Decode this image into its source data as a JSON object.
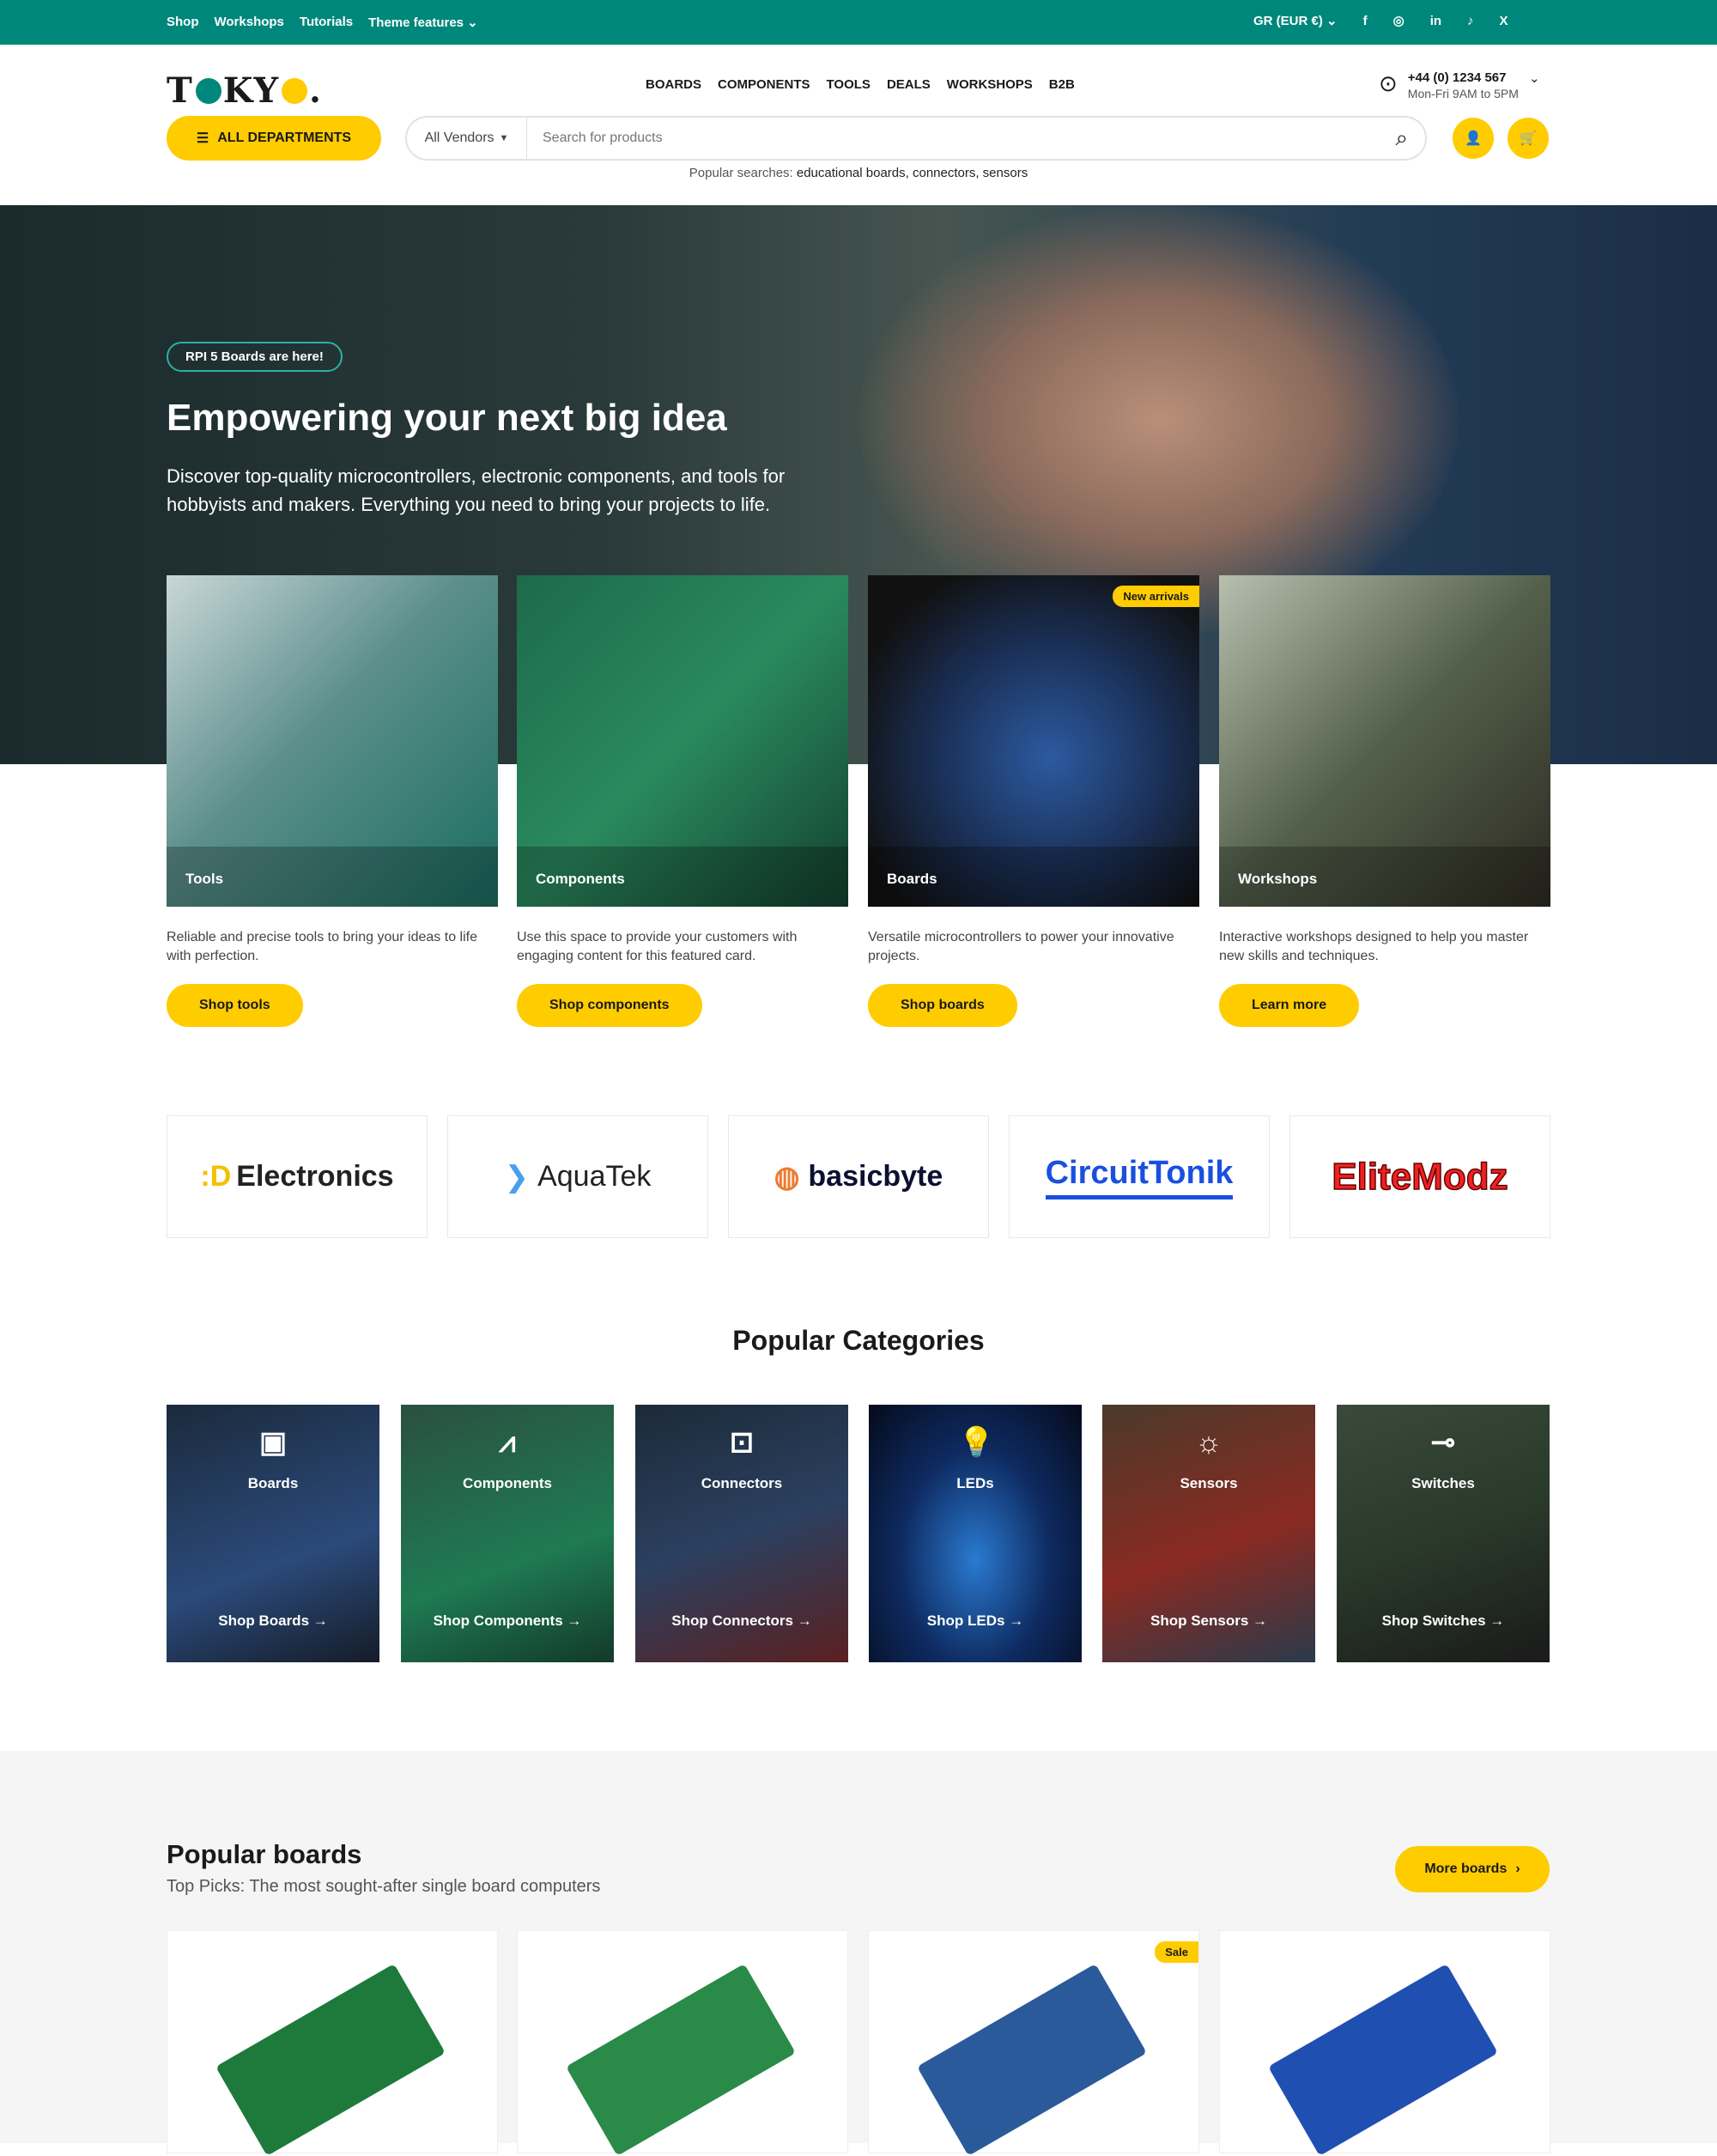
{
  "topbar": {
    "links": [
      "Shop",
      "Workshops",
      "Tutorials",
      "Theme features"
    ],
    "currency": "GR (EUR €)",
    "social": [
      "facebook-icon",
      "instagram-icon",
      "linkedin-icon",
      "tiktok-icon",
      "x-icon"
    ]
  },
  "header": {
    "logo": "TOKYO.",
    "nav": [
      "BOARDS",
      "COMPONENTS",
      "TOOLS",
      "DEALS",
      "WORKSHOPS",
      "B2B"
    ],
    "phone": "+44 (0) 1234 567",
    "hours": "Mon-Fri 9AM to 5PM",
    "departments": "ALL DEPARTMENTS",
    "vendor": "All Vendors",
    "search_placeholder": "Search for products",
    "popular_label": "Popular searches:",
    "popular_terms": "educational boards, connectors, sensors"
  },
  "hero": {
    "badge": "RPI 5 Boards are here!",
    "title": "Empowering your next big idea",
    "description": "Discover top-quality microcontrollers, electronic components, and tools for hobbyists and makers. Everything you need to bring your projects to life."
  },
  "cards": [
    {
      "label": "Tools",
      "desc": "Reliable and precise tools to bring your ideas to life with perfection.",
      "button": "Shop tools"
    },
    {
      "label": "Components",
      "desc": "Use this space to provide your customers with engaging content for this featured card.",
      "button": "Shop components"
    },
    {
      "label": "Boards",
      "desc": "Versatile microcontrollers to power your innovative projects.",
      "button": "Shop boards",
      "badge": "New arrivals"
    },
    {
      "label": "Workshops",
      "desc": "Interactive workshops designed to help you master new skills and techniques.",
      "button": "Learn more"
    }
  ],
  "brands": [
    "Electronics",
    "AquaTek",
    "basicbyte",
    "CircuitTonik",
    "EliteModz"
  ],
  "categories": {
    "title": "Popular Categories",
    "items": [
      {
        "name": "Boards",
        "link": "Shop Boards →",
        "icon": "chip-icon"
      },
      {
        "name": "Components",
        "link": "Shop Components →",
        "icon": "waveform-icon"
      },
      {
        "name": "Connectors",
        "link": "Shop Connectors →",
        "icon": "connector-icon"
      },
      {
        "name": "LEDs",
        "link": "Shop LEDs →",
        "icon": "bulb-icon"
      },
      {
        "name": "Sensors",
        "link": "Shop Sensors →",
        "icon": "solar-panel-icon"
      },
      {
        "name": "Switches",
        "link": "Shop Switches →",
        "icon": "switch-icon"
      }
    ]
  },
  "boards": {
    "title": "Popular boards",
    "subtitle": "Top Picks: The most sought-after single board computers",
    "more": "More boards",
    "sale_badge": "Sale"
  }
}
